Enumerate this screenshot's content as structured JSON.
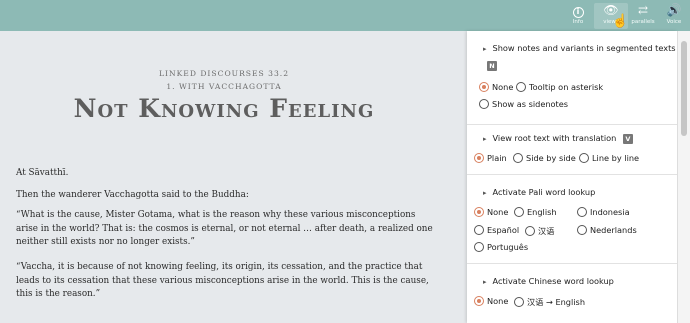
{
  "topbar": {
    "buttons": {
      "info": {
        "label": "Info",
        "icon": "i"
      },
      "views": {
        "label": "views",
        "icon": "👁"
      },
      "parallels": {
        "label": "parallels",
        "icon": "⇄"
      },
      "voice": {
        "label": "Voice",
        "icon": "🔊"
      }
    },
    "color": "#8dbab5"
  },
  "content": {
    "division1": "LINKED DISCOURSES 33.2",
    "division2": "1. WITH VACCHAGOTTA",
    "title": "Not Knowing Feeling",
    "paragraphs": [
      "At Sāvatthī.",
      "Then the wanderer Vacchagotta said to the Buddha:",
      "“What is the cause, Mister Gotama, what is the reason why these various misconceptions arise in the world? That is: the cosmos is eternal, or not eternal … after death, a realized one neither still exists nor no longer exists.”",
      "“Vaccha, it is because of not knowing feeling, its origin, its cessation, and the practice that leads to its cessation that these various misconceptions arise in the world. This is the cause, this is the reason.”"
    ]
  },
  "panel": {
    "notes": {
      "heading": "Show notes and variants in segmented texts",
      "key": "N",
      "options": [
        "None",
        "Tooltip on asterisk",
        "Show as sidenotes"
      ],
      "selected": "None"
    },
    "root": {
      "heading": "View root text with translation",
      "key": "V",
      "options": [
        "Plain",
        "Side by side",
        "Line by line"
      ],
      "selected": "Plain"
    },
    "pali": {
      "heading": "Activate Pali word lookup",
      "options": [
        "None",
        "English",
        "Indonesia",
        "Español",
        "汉语",
        "Nederlands",
        "Português"
      ],
      "selected": "None"
    },
    "chinese": {
      "heading": "Activate Chinese word lookup",
      "options": [
        "None",
        "汉语 → English"
      ],
      "selected": "None"
    },
    "accent_color": "#d8805f"
  }
}
